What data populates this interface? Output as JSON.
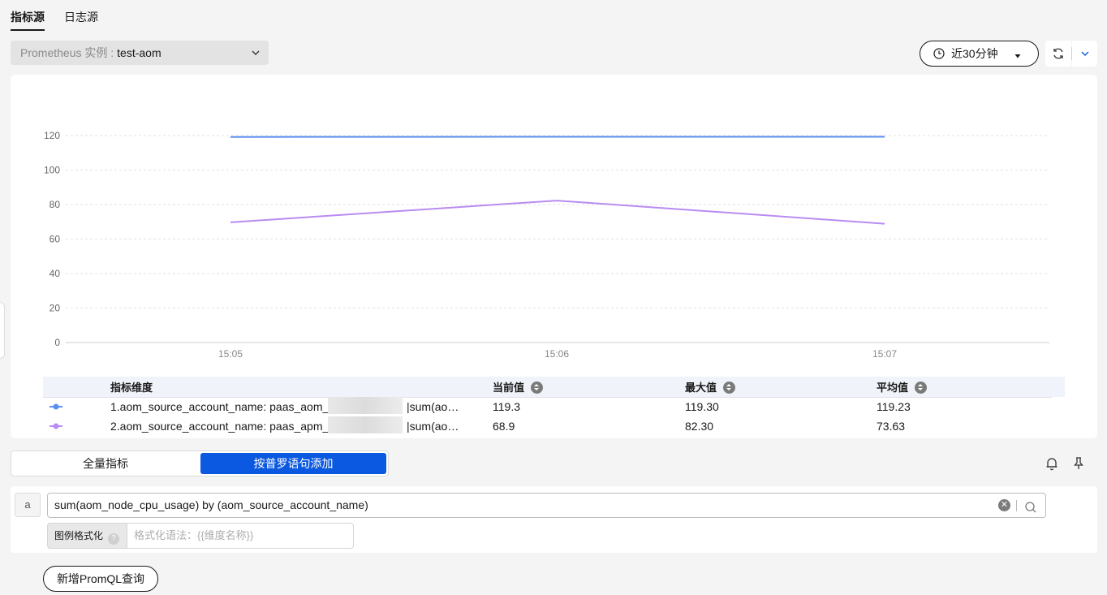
{
  "tabs": [
    {
      "label": "指标源",
      "active": true
    },
    {
      "label": "日志源",
      "active": false
    }
  ],
  "instance_select": {
    "label": "Prometheus 实例 :",
    "value": "test-aom"
  },
  "time_range": {
    "label": "近30分钟"
  },
  "chart_data": {
    "type": "line",
    "x": [
      "15:05",
      "15:06",
      "15:07"
    ],
    "ylim": [
      0,
      120
    ],
    "yticks": [
      "0",
      "20",
      "40",
      "60",
      "80",
      "100",
      "120"
    ],
    "grid": true,
    "series": [
      {
        "name": "1.aom_source_account_name: paas_aom_",
        "color": "#5b8ff0",
        "values": [
          119.2,
          119.3,
          119.3
        ]
      },
      {
        "name": "2.aom_source_account_name: paas_apm_",
        "color": "#b98cf0",
        "values": [
          69.7,
          82.3,
          68.9
        ]
      }
    ]
  },
  "legend": {
    "headers": {
      "dimension": "指标维度",
      "current": "当前值",
      "max": "最大值",
      "avg": "平均值"
    },
    "rows": [
      {
        "name": "1.aom_source_account_name: paas_aom_",
        "suffix": "|sum(ao…",
        "current": "119.3",
        "max": "119.30",
        "avg": "119.23",
        "color": "#5b8ff0"
      },
      {
        "name": "2.aom_source_account_name: paas_apm_",
        "suffix": "|sum(ao…",
        "current": "68.9",
        "max": "82.30",
        "avg": "73.63",
        "color": "#b98cf0"
      }
    ]
  },
  "mode_switch": {
    "all_metrics": "全量指标",
    "promql": "按普罗语句添加"
  },
  "query": {
    "index": "a",
    "expression": "sum(aom_node_cpu_usage) by (aom_source_account_name)",
    "legend_format_label": "图例格式化",
    "legend_format_placeholder": "格式化语法：{{维度名称}}"
  },
  "add_query_button": "新增PromQL查询"
}
